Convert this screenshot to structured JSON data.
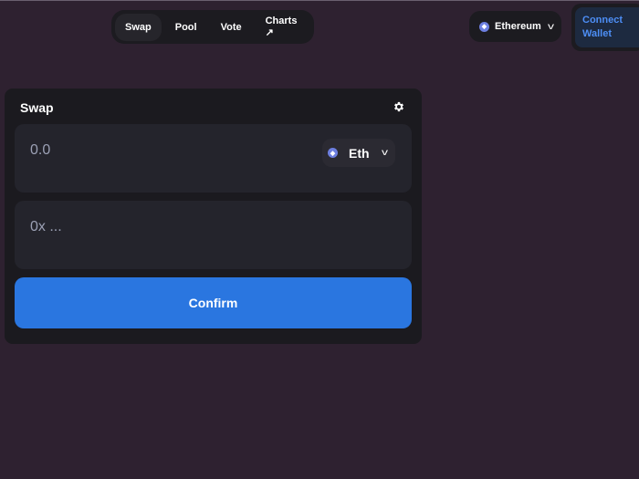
{
  "nav": {
    "items": [
      {
        "label": "Swap"
      },
      {
        "label": "Pool"
      },
      {
        "label": "Vote"
      },
      {
        "label": "Charts ↗"
      }
    ]
  },
  "network": {
    "label": "Ethereum",
    "icon": "ethereum-icon"
  },
  "wallet": {
    "line1": "Connect",
    "line2": "Wallet"
  },
  "swap": {
    "title": "Swap",
    "amount_placeholder": "0.0",
    "token": "Eth",
    "address_placeholder": "0x ...",
    "confirm_label": "Confirm"
  },
  "colors": {
    "background": "#2e2130",
    "card": "#1b1a1f",
    "accent": "#2a76e0",
    "wallet_text": "#4d8ef5"
  }
}
